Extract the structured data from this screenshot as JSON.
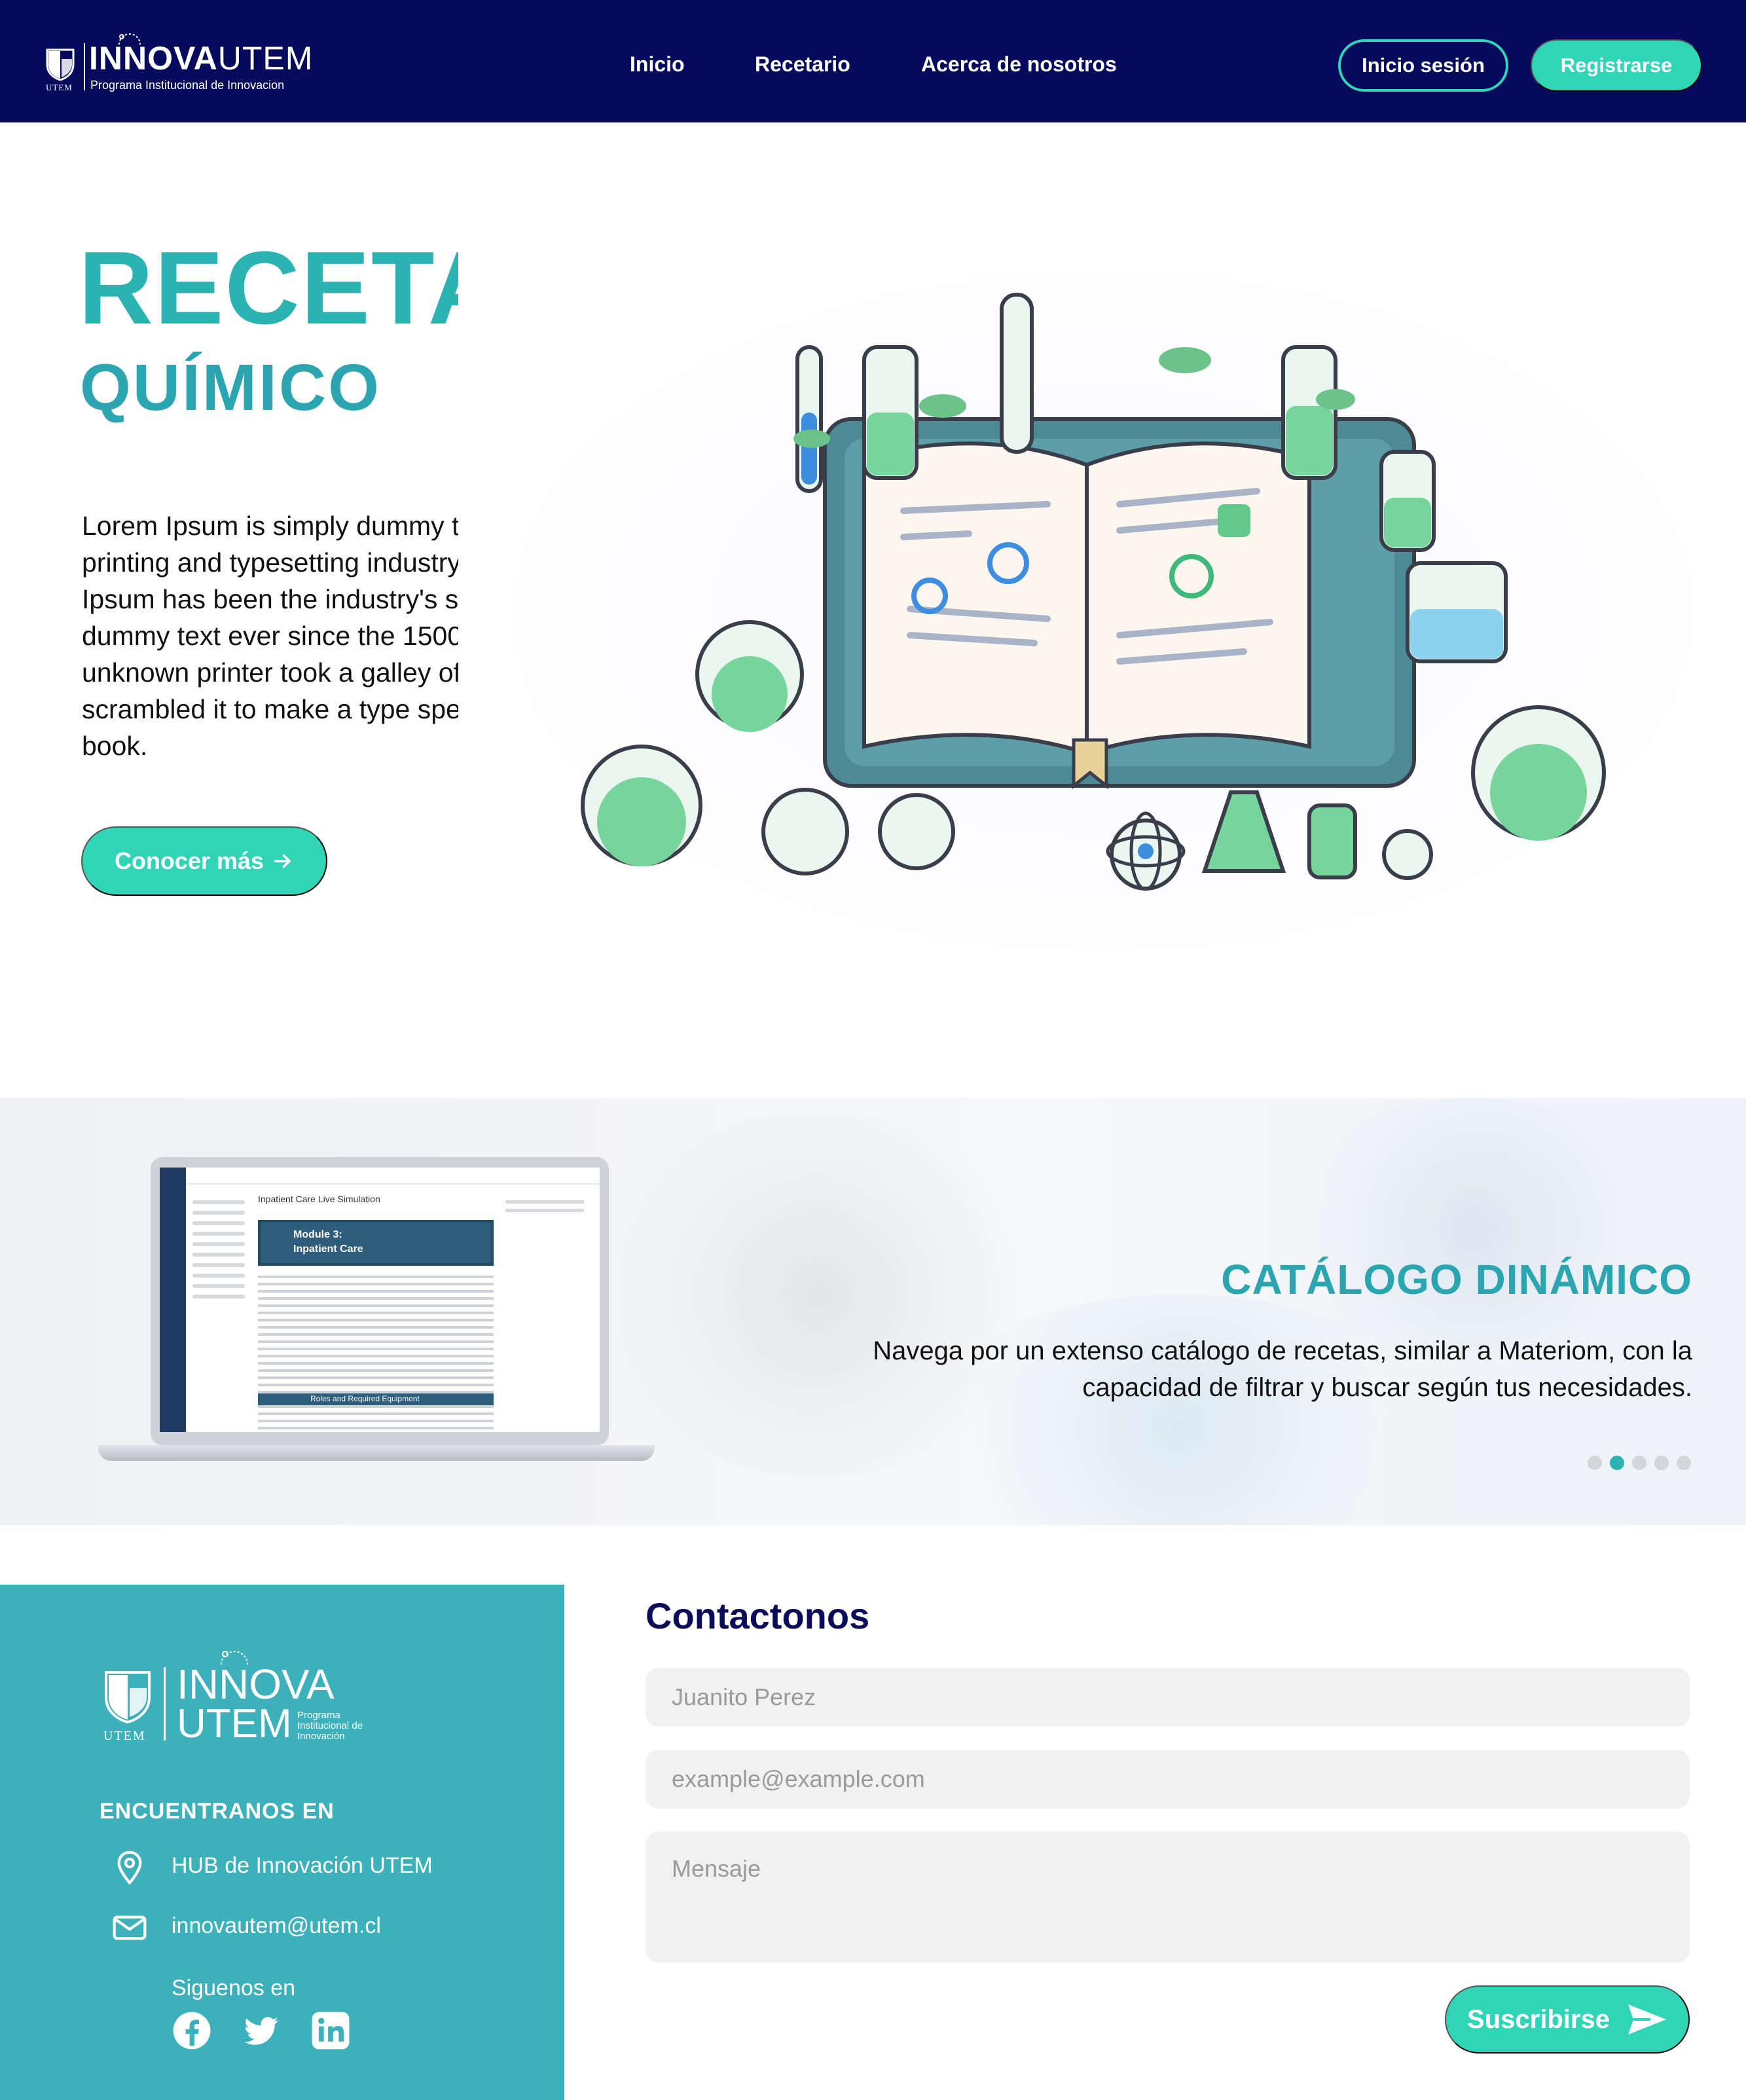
{
  "navbar": {
    "logo": {
      "brand_bold": "INNOVA",
      "brand_light": "UTEM",
      "tagline": "Programa Institucional de Innovacion",
      "shield_label": "UTEM"
    },
    "links": [
      {
        "label": "Inicio"
      },
      {
        "label": "Recetario"
      },
      {
        "label": "Acerca de nosotros"
      }
    ],
    "login_label": "Inicio sesión",
    "register_label": "Registrarse",
    "colors": {
      "background": "#060a5c",
      "accent": "#2fd5b6"
    }
  },
  "hero": {
    "title": "RECETARIO",
    "subtitle": "QUÍMICO",
    "text": "Lorem Ipsum is simply dummy text of the printing and typesetting industry. Lorem Ipsum has been the industry's standard dummy text ever since the 1500s, when an unknown printer took a galley of type and scrambled it to make a type specimen book.",
    "cta_label": "Conocer más",
    "cta_icon": "arrow-right-icon",
    "illustration": "chemistry-book-illustration",
    "colors": {
      "title": "#2ab3b0"
    }
  },
  "catalog": {
    "title": "CATÁLOGO DINÁMICO",
    "text": "Navega por un extenso catálogo de recetas, similar a Materiom, con la capacidad de filtrar y buscar según tus necesidades.",
    "laptop": {
      "page_title": "Inpatient Care Live Simulation",
      "module_title": "Module 3:",
      "module_subtitle": "Inpatient Care",
      "section_bar": "Roles and Required Equipment"
    },
    "dots_total": 5,
    "active_dot": 1
  },
  "footer": {
    "logo": {
      "line1": "INNOVA",
      "line2": "UTEM",
      "program": "Programa Institucional de Innovación",
      "shield_label": "UTEM"
    },
    "find_us_title": "ENCUENTRANOS EN",
    "address": "HUB de Innovación UTEM",
    "email": "innovautem@utem.cl",
    "follow_label": "Siguenos en",
    "socials": [
      "facebook-icon",
      "twitter-icon",
      "linkedin-icon"
    ],
    "colors": {
      "background": "#3cb1bb"
    }
  },
  "contact": {
    "title": "Contactonos",
    "name_placeholder": "Juanito Perez",
    "email_placeholder": "example@example.com",
    "message_placeholder": "Mensaje",
    "submit_label": "Suscribirse",
    "submit_icon": "send-icon",
    "colors": {
      "title": "#0b0c5a"
    }
  }
}
